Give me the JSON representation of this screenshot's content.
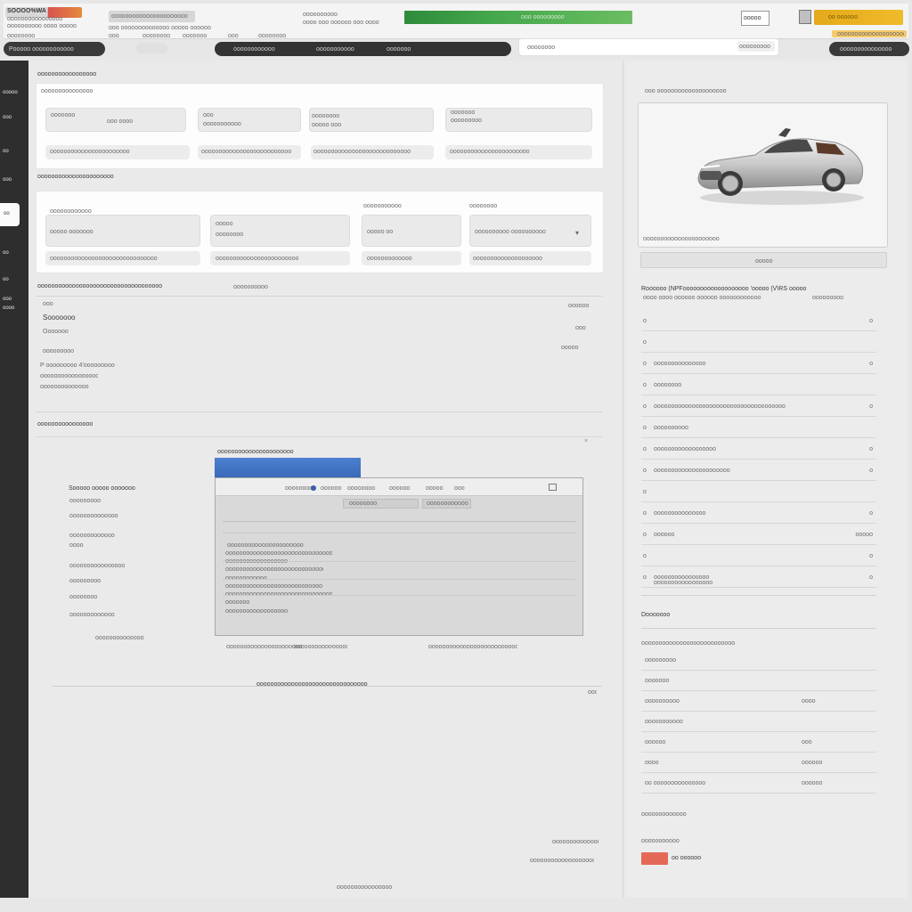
{
  "header": {
    "brand_line1": "SOOOO%WA",
    "brand_line2": "oooooooooooooooo",
    "brand_line3": "oooooooooo  oooo  ooooo",
    "title_box": "oooooooooooooooooooooo",
    "title_sub": "ooo  oooooooooooooo  ooooo  oooooo",
    "center_label": "oooooooooo",
    "center_sub": "oooo  ooo  oooooo  ooo  oooo",
    "progress_label": "ooo  ooooooooo",
    "badge_label": "ooooo",
    "yellow_button": "oo  oooooo",
    "right_sub": "oooooooooooooooooooooo",
    "nav_left": "Pooooo  oooooooooooo",
    "nav_row_left": [
      "oooooooo",
      "ooo",
      "oooooooo",
      "ooooooo",
      "ooo",
      "oooooooo"
    ],
    "nav_mid": [
      "oooooooooooo",
      "ooooooooooo",
      "ooooooo"
    ],
    "search_placeholder": "oooooooo",
    "search_badge": "ooooooooo",
    "nav_right": "ooooooooooooooo",
    "colors": {
      "accent_green": "#45a84d",
      "accent_yellow": "#f0bb2a",
      "accent_red": "#d9534f",
      "dark": "#333333"
    }
  },
  "sidebar": {
    "items": [
      "ooooo",
      "ooo",
      "oo",
      "ooo",
      "oo",
      "oo",
      "ooo",
      "oooo"
    ],
    "active_item": "oo"
  },
  "main": {
    "section1_title": "ooooooooooooooooo",
    "section1_sub": "ooooooooooooooo",
    "form1_fields": [
      {
        "label": "ooooooo",
        "value": "ooo oooo"
      },
      {
        "label": "ooo",
        "value": "ooooooooooo"
      },
      {
        "label": "oooooooo",
        "value": "ooooo ooo"
      },
      {
        "label": "ooooooo",
        "value": "ooooooooo"
      }
    ],
    "form1_row2": [
      "ooooooooooooooooooooooo",
      "oooooooooooooooooooooooooo",
      "oooooooooooooooooooooooooooo",
      "ooooooooooooooooooooooo"
    ],
    "section2_title": "oooooooooooooooooooooo",
    "form2_fields": [
      {
        "label": "oooooooooooo",
        "value": "ooooo  ooooooo"
      },
      {
        "label": "ooooo",
        "value": "oooooooo"
      },
      {
        "label": "ooooooooooo",
        "value": "ooooo oo"
      },
      {
        "label": "oooooooo",
        "value": "oooooooooo oooooooooo"
      }
    ],
    "form2_row2": [
      "ooooooooooooooooooooooooooooooo",
      "oooooooooooooooooooooooo",
      "ooooooooooooo",
      "oooooooooooooooooooo"
    ],
    "section3_title": "oooooooooooooooooooooooooooooooooooo",
    "section3_side": "oooooooooo",
    "info_lines": [
      "ooo",
      "Sooooooo",
      "Ooooooo",
      "ooooooooo",
      "P ooooooooo  4'ooooooooo",
      "oooooooooooooooooo",
      "oooooooooooooo"
    ],
    "info_right": [
      "oooooo",
      "ooo",
      "ooooo"
    ],
    "section4_title": "oooooooooooooooo",
    "left_list_title": "Sooooo ooooo ooooooo",
    "left_list": [
      "ooooooooo",
      "oooooooooooooo",
      "ooooooooooooo",
      "oooo",
      "oooooooooooooooo",
      "ooooooooo",
      "oooooooo",
      "ooooooooooooo"
    ],
    "dialog_title": "oooooooooooooooooooooo",
    "dialog_head": [
      "ooooooooooooooo",
      "oooooo",
      "oooooooo",
      "oooooo",
      "ooooo",
      "ooo"
    ],
    "dialog_input1": "oooooooo",
    "dialog_input2": "oooooooooooo",
    "dialog_lines": [
      "oooooooooooooooooooooo",
      "ooooooooooooooooooooooooooooooo",
      "oooooooooooooooooo",
      "ooooooooooooooooooooooooooooo",
      "oooooooooooo",
      "oooooooooooooooooooooooooooo",
      "ooooooooooooooooooooooooooooooooooo",
      "ooooooo",
      "ooooooooooooooooooo"
    ],
    "dialog_footer": [
      "ooooooooooooooooooooooooo",
      "oooooooooooooooooo",
      "ooooooooooooooooooooooooooooo"
    ],
    "bottom_link": "ooooooooooooooooooooooooooooooooooooooooooo",
    "footer_right1": "oooooooooooooo",
    "footer_right2": "oooooooooooooooooooo",
    "footer_center": "oooooooooooooooo"
  },
  "right": {
    "top_label": "ooo  oooooooooooooooooooo",
    "car_caption": "oooooooooooooooooooooo",
    "card_button": "ooooo",
    "spec_title": "Roooooo (NPFooooooooooooooooooo  'ooooo (V\\RS ooooo",
    "spec_sub": "oooo oooo  oooooo  oooooo  oooooooooooo",
    "spec_sub_right": "ooooooooo",
    "spec_rows": [
      {
        "l": "o",
        "m": "",
        "r": "o"
      },
      {
        "l": "o",
        "m": "",
        "r": ""
      },
      {
        "l": "o",
        "m": "ooooooooooooooo",
        "r": "o"
      },
      {
        "l": "o",
        "m": "oooooooo",
        "r": ""
      },
      {
        "l": "o",
        "m": "oooooooooooooooooooooooooooooooooooooo",
        "r": "o"
      },
      {
        "l": "o",
        "m": "oooooooooo",
        "r": ""
      },
      {
        "l": "o",
        "m": "oooooooooooooooooo",
        "r": "o"
      },
      {
        "l": "o",
        "m": "oooooooooooooooooooooo",
        "r": "o"
      },
      {
        "l": "o",
        "m": "",
        "r": ""
      },
      {
        "l": "o",
        "m": "ooooooooooooooo",
        "r": "o"
      },
      {
        "l": "o",
        "m": "oooooo",
        "r": "ooooo"
      },
      {
        "l": "o",
        "m": "",
        "r": "o"
      },
      {
        "l": "o",
        "m": "oooooooooooooooo",
        "r": "o"
      }
    ],
    "spec_footer": "ooooooooooooooooo",
    "section2_title": "Dooooooo",
    "section2_sub": "ooooooooooooooooooooooooooo",
    "section2_rows": [
      {
        "l": "ooooooooo",
        "r": ""
      },
      {
        "l": "ooooooo",
        "r": ""
      },
      {
        "l": "oooooooooo",
        "r": "oooo"
      },
      {
        "l": "ooooooooooo",
        "r": ""
      },
      {
        "l": "oooooo",
        "r": "ooo"
      },
      {
        "l": "oooo",
        "r": "oooooo"
      },
      {
        "l": "oo  ooooooooooooooo",
        "r": "oooooo"
      }
    ],
    "footer_title": "ooooooooooooo",
    "footer_sub": "ooooooooooo",
    "footer_action": "oo  oooooo"
  }
}
